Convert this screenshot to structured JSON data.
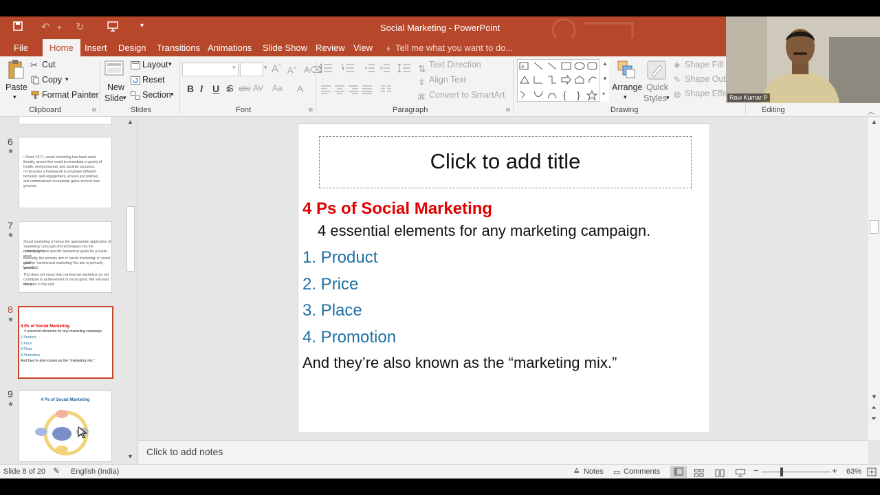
{
  "window": {
    "title": "Social Marketing - PowerPoint"
  },
  "tabs": [
    {
      "label": "File"
    },
    {
      "label": "Home"
    },
    {
      "label": "Insert"
    },
    {
      "label": "Design"
    },
    {
      "label": "Transitions"
    },
    {
      "label": "Animations"
    },
    {
      "label": "Slide Show"
    },
    {
      "label": "Review"
    },
    {
      "label": "View"
    }
  ],
  "tell_me": "Tell me what you want to do...",
  "ribbon": {
    "clipboard": {
      "paste": "Paste",
      "cut": "Cut",
      "copy": "Copy",
      "format_painter": "Format Painter",
      "label": "Clipboard"
    },
    "slides": {
      "new_slide_1": "New",
      "new_slide_2": "Slide",
      "layout": "Layout",
      "reset": "Reset",
      "section": "Section",
      "label": "Slides"
    },
    "font": {
      "label": "Font",
      "bold": "B",
      "italic": "I",
      "underline": "U",
      "strike": "abc"
    },
    "paragraph": {
      "text_direction": "Text Direction",
      "align_text": "Align Text",
      "convert": "Convert to SmartArt",
      "label": "Paragraph"
    },
    "drawing": {
      "arrange": "Arrange",
      "quick_1": "Quick",
      "quick_2": "Styles",
      "shape_fill": "Shape Fill",
      "shape_outline": "Shape Outl",
      "shape_effects": "Shape Effec",
      "label": "Drawing"
    },
    "editing": {
      "label": "Editing"
    }
  },
  "webcam": {
    "name": "Ravi Kumar P"
  },
  "thumbnails": [
    {
      "num": "6",
      "lines": [
        "• Since 1971, social marketing has been used,",
        "  literally, around the world to remediate a variety of",
        "  health, environmental, and societal concerns.",
        "• It provides a framework to empower different",
        "  behavior, skill engagement, ensure just policies,",
        "  and communicate to maintain gains and not lose",
        "  grounds."
      ]
    },
    {
      "num": "7",
      "lines": [
        "Social marketing is hence the appropriate application of",
        "'marketing' concepts and techniques into the community in",
        "order to achieve specific behavioral goals for a social good.",
        "Basically, the primary aim of 'social marketing' is 'social good',",
        "while in 'commercial marketing' the aim is primarily 'personal",
        "benefit'.",
        "This does not mean that commercial marketers do not",
        "contribute to achievement of social good. We will read about",
        "this later in this unit."
      ]
    },
    {
      "num": "8",
      "title": "4 Ps of Social Marketing",
      "sub": "4 essential elements for any marketing campaign.",
      "items": [
        "1  Product",
        "2  Price",
        "3  Place",
        "4  Promotion"
      ],
      "footer": "And they're also known as the \"marketing mix.\""
    },
    {
      "num": "9",
      "title": "4 Ps of Social Marketing"
    }
  ],
  "slide": {
    "title_placeholder": "Click to add title",
    "heading": "4 Ps of Social Marketing",
    "subheading": "4 essential elements for any marketing campaign.",
    "items": [
      "1. Product",
      "2. Price",
      "3. Place",
      "4. Promotion"
    ],
    "closing": "And they’re also known as the “marketing mix.”"
  },
  "notes_placeholder": "Click to add notes",
  "status": {
    "slide_info": "Slide 8 of 20",
    "language": "English (India)",
    "notes": "Notes",
    "comments": "Comments",
    "zoom": "63%"
  },
  "colors": {
    "accent": "#b7472a",
    "heading_red": "#e00000",
    "list_blue": "#1f6fa3"
  }
}
